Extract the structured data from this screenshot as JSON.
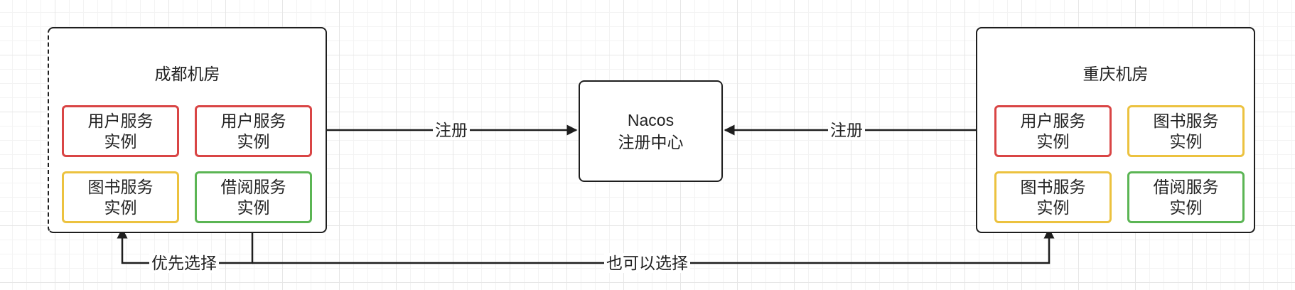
{
  "chengdu": {
    "title": "成都机房",
    "services": [
      {
        "line1": "用户服务",
        "line2": "实例",
        "color": "#d94545"
      },
      {
        "line1": "用户服务",
        "line2": "实例",
        "color": "#d94545"
      },
      {
        "line1": "图书服务",
        "line2": "实例",
        "color": "#ecc23f"
      },
      {
        "line1": "借阅服务",
        "line2": "实例",
        "color": "#5bb554"
      }
    ]
  },
  "chongqing": {
    "title": "重庆机房",
    "services": [
      {
        "line1": "用户服务",
        "line2": "实例",
        "color": "#d94545"
      },
      {
        "line1": "图书服务",
        "line2": "实例",
        "color": "#ecc23f"
      },
      {
        "line1": "图书服务",
        "line2": "实例",
        "color": "#ecc23f"
      },
      {
        "line1": "借阅服务",
        "line2": "实例",
        "color": "#5bb554"
      }
    ]
  },
  "nacos": {
    "line1": "Nacos",
    "line2": "注册中心"
  },
  "edges": {
    "register_left": "注册",
    "register_right": "注册",
    "prefer": "优先选择",
    "also": "也可以选择"
  }
}
